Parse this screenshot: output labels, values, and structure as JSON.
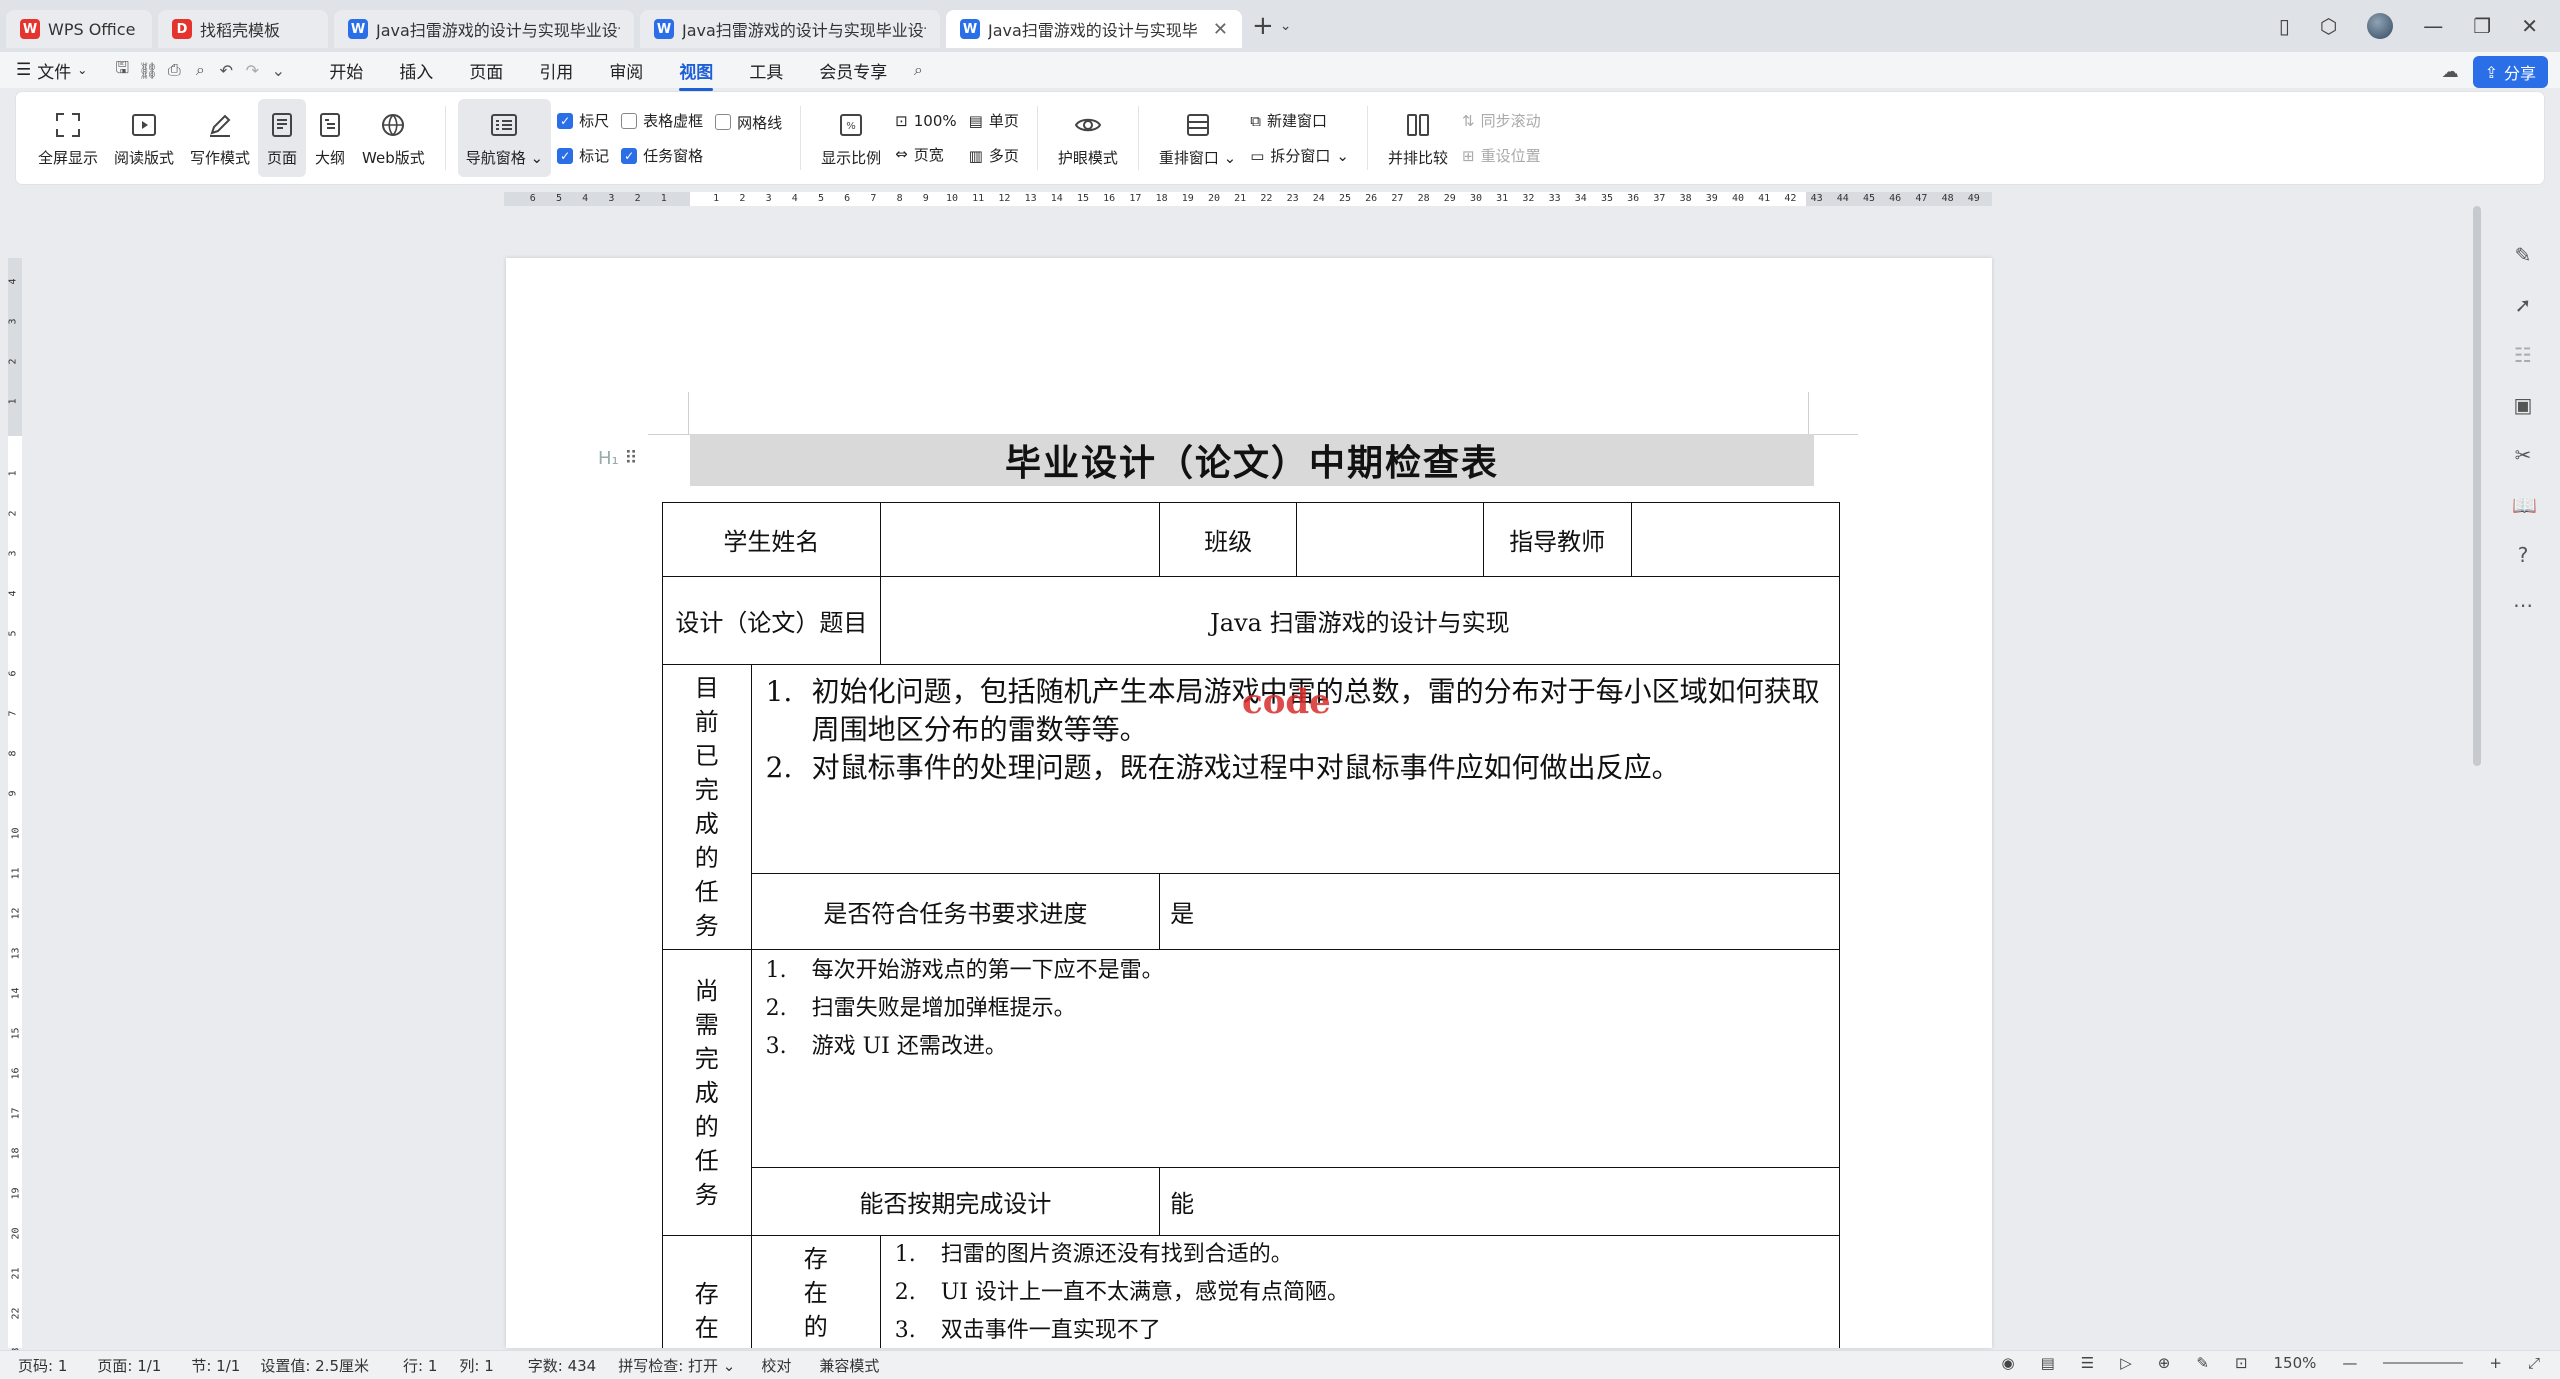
{
  "tabs": [
    {
      "label": "WPS Office",
      "icon": "wps-logo-icon",
      "color": "#e5342d"
    },
    {
      "label": "找稻壳模板",
      "icon": "docer-logo-icon",
      "color": "#e5342d"
    },
    {
      "label": "Java扫雷游戏的设计与实现毕业设计论",
      "icon": "writer-doc-icon",
      "color": "#2a6fe8"
    },
    {
      "label": "Java扫雷游戏的设计与实现毕业设计任",
      "icon": "writer-doc-icon",
      "color": "#2a6fe8"
    },
    {
      "label": "Java扫雷游戏的设计与实现毕业设",
      "icon": "writer-doc-icon",
      "color": "#2a6fe8",
      "active": true
    }
  ],
  "menubar": {
    "file_label": "文件",
    "tabs": [
      "开始",
      "插入",
      "页面",
      "引用",
      "审阅",
      "视图",
      "工具",
      "会员专享"
    ],
    "active_tab": "视图",
    "share_label": "分享"
  },
  "ribbon": {
    "fullscreen": "全屏显示",
    "reading": "阅读版式",
    "writing": "写作模式",
    "page": "页面",
    "outline": "大纲",
    "web": "Web版式",
    "nav_pane": "导航窗格",
    "ruler": "标尺",
    "table_gridlines": "表格虚框",
    "gridlines": "网格线",
    "markup": "标记",
    "task_pane": "任务窗格",
    "zoom": "显示比例",
    "hundred": "100%",
    "single_page": "单页",
    "page_width": "页宽",
    "multi_page": "多页",
    "eye_care": "护眼模式",
    "rearrange": "重排窗口",
    "new_window": "新建窗口",
    "split_window": "拆分窗口",
    "side_by_side": "并排比较",
    "sync_scroll": "同步滚动",
    "reset_position": "重设位置"
  },
  "ruler": {
    "h_left": [
      "6",
      "5",
      "4",
      "3",
      "2",
      "1"
    ],
    "h_right": [
      "1",
      "2",
      "3",
      "4",
      "5",
      "6",
      "7",
      "8",
      "9",
      "10",
      "11",
      "12",
      "13",
      "14",
      "15",
      "16",
      "17",
      "18",
      "19",
      "20",
      "21",
      "22",
      "23",
      "24",
      "25",
      "26",
      "27",
      "28",
      "29",
      "30",
      "31",
      "32",
      "33",
      "34",
      "35",
      "36",
      "37",
      "38",
      "39",
      "40",
      "41",
      "42",
      "43",
      "44",
      "45",
      "46",
      "47",
      "48",
      "49"
    ],
    "v_top": [
      "4",
      "3",
      "2",
      "1"
    ],
    "v_main": [
      "1",
      "2",
      "3",
      "4",
      "5",
      "6",
      "7",
      "8",
      "9",
      "10",
      "11",
      "12",
      "13",
      "14",
      "15",
      "16",
      "17",
      "18",
      "19",
      "20",
      "21",
      "22",
      "23"
    ]
  },
  "document": {
    "title": "毕业设计（论文）中期检查表",
    "student_name_label": "学生姓名",
    "class_label": "班级",
    "advisor_label": "指导教师",
    "topic_label": "设计（论文）题目",
    "topic_value": "Java 扫雷游戏的设计与实现",
    "completed_label": [
      "目",
      "前",
      "已",
      "完",
      "成",
      "的",
      "任",
      "务"
    ],
    "completed_items": [
      {
        "num": "1.",
        "text": "初始化问题，包括随机产生本局游戏中雷的总数，雷的分布对于每小区域如何获取周围地区分布的雷数等等。"
      },
      {
        "num": "2.",
        "text": "对鼠标事件的处理问题，既在游戏过程中对鼠标事件应如何做出反应。"
      }
    ],
    "on_schedule_label": "是否符合任务书要求进度",
    "on_schedule_value": "是",
    "remaining_label": [
      "尚",
      "需",
      "完",
      "成",
      "的",
      "任",
      "务"
    ],
    "remaining_items": [
      {
        "num": "1.",
        "text": "每次开始游戏点的第一下应不是雷。"
      },
      {
        "num": "2.",
        "text": "扫雷失败是增加弹框提示。"
      },
      {
        "num": "3.",
        "text": "游戏 UI 还需改进。"
      }
    ],
    "can_finish_label": "能否按期完成设计",
    "can_finish_value": "能",
    "issues_label_outer": [
      "存",
      "在"
    ],
    "issues_label_inner": [
      "存",
      "在",
      "的"
    ],
    "issues_items": [
      {
        "num": "1.",
        "text": "扫雷的图片资源还没有找到合适的。"
      },
      {
        "num": "2.",
        "text": "UI 设计上一直不太满意，感觉有点简陋。"
      },
      {
        "num": "3.",
        "text": "双击事件一直实现不了"
      }
    ],
    "heading_marker": "H₁",
    "watermark": "code"
  },
  "status": {
    "page_num": "页码: 1",
    "pages": "页面: 1/1",
    "section": "节: 1/1",
    "setting": "设置值: 2.5厘米",
    "line": "行: 1",
    "column": "列: 1",
    "word_count": "字数: 434",
    "spell_check": "拼写检查: 打开",
    "proofread": "校对",
    "compat_mode": "兼容模式",
    "zoom": "150%"
  },
  "colors": {
    "accent": "#2a6fe8",
    "wps_red": "#e5342d",
    "heading_bg": "#d9d9d9"
  }
}
